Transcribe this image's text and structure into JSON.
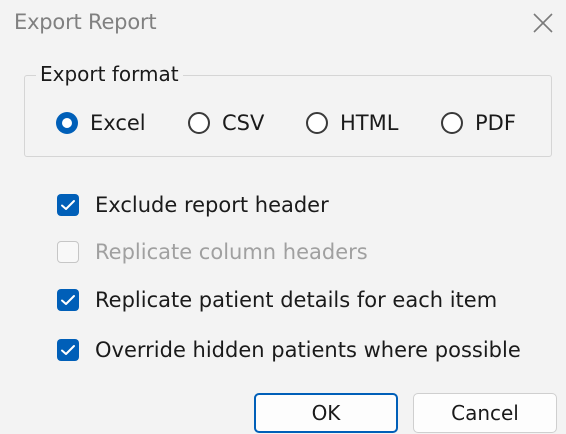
{
  "window": {
    "title": "Export Report"
  },
  "export_format": {
    "legend": "Export format",
    "options": [
      {
        "label": "Excel",
        "selected": true
      },
      {
        "label": "CSV",
        "selected": false
      },
      {
        "label": "HTML",
        "selected": false
      },
      {
        "label": "PDF",
        "selected": false
      }
    ]
  },
  "options": [
    {
      "label": "Exclude report header",
      "checked": true,
      "enabled": true
    },
    {
      "label": "Replicate column headers",
      "checked": false,
      "enabled": false
    },
    {
      "label": "Replicate patient details for each item",
      "checked": true,
      "enabled": true
    },
    {
      "label": "Override hidden patients where possible",
      "checked": true,
      "enabled": true
    }
  ],
  "buttons": {
    "ok": "OK",
    "cancel": "Cancel"
  },
  "colors": {
    "accent": "#005fb8",
    "background": "#f3f3f3",
    "disabled_text": "#a0a0a0"
  }
}
